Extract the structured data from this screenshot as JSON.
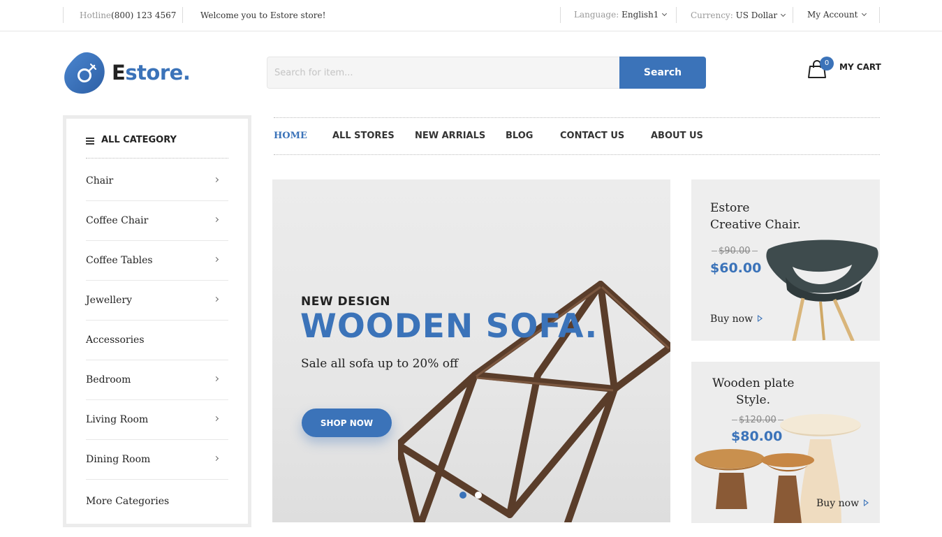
{
  "topbar": {
    "hotline_label": "Hotline",
    "hotline_number": "(800) 123 4567",
    "welcome": "Welcome you to Estore store!",
    "language_label": "Language:",
    "language_value": "English1",
    "currency_label": "Currency:",
    "currency_value": "US Dollar",
    "account_label": "My Account"
  },
  "header": {
    "logo_first": "E",
    "logo_rest": "store.",
    "search_placeholder": "Search for item...",
    "search_button": "Search",
    "cart_count": "0",
    "cart_label": "MY CART"
  },
  "sidebar": {
    "title": "ALL CATEGORY",
    "items": [
      {
        "label": "Chair",
        "has_arrow": true
      },
      {
        "label": "Coffee Chair",
        "has_arrow": true
      },
      {
        "label": "Coffee Tables",
        "has_arrow": true
      },
      {
        "label": "Jewellery",
        "has_arrow": true
      },
      {
        "label": "Accessories",
        "has_arrow": false
      },
      {
        "label": "Bedroom",
        "has_arrow": true
      },
      {
        "label": "Living Room",
        "has_arrow": true
      },
      {
        "label": "Dining Room",
        "has_arrow": true
      }
    ],
    "more_label": "More Categories"
  },
  "nav": {
    "items": [
      "HOME",
      "ALL STORES",
      "NEW ARRIALS",
      "BLOG",
      "CONTACT US",
      "ABOUT US"
    ],
    "active_index": 0
  },
  "hero": {
    "subtitle": "NEW DESIGN",
    "title": "WOODEN SOFA.",
    "description": "Sale all sofa up to 20% off",
    "button": "SHOP NOW",
    "slides": 2,
    "active_slide": 0
  },
  "promos": [
    {
      "title_line1": "Estore",
      "title_line2": "Creative Chair.",
      "old_price": "$90.00",
      "price": "$60.00",
      "link": "Buy now"
    },
    {
      "title_line1": "Wooden plate",
      "title_line2": "Style.",
      "old_price": "$120.00",
      "price": "$80.00",
      "link": "Buy now"
    }
  ],
  "colors": {
    "accent": "#3b73b9",
    "text": "#222222",
    "muted": "#999999",
    "panel": "#eeeeee"
  },
  "icons": {
    "cart": "shopping-bag-icon",
    "menu": "hamburger-icon",
    "logo": "estore-logo-icon",
    "chevron": "chevron-down-icon",
    "arrow": "chevron-right-icon",
    "play": "play-triangle-icon"
  }
}
